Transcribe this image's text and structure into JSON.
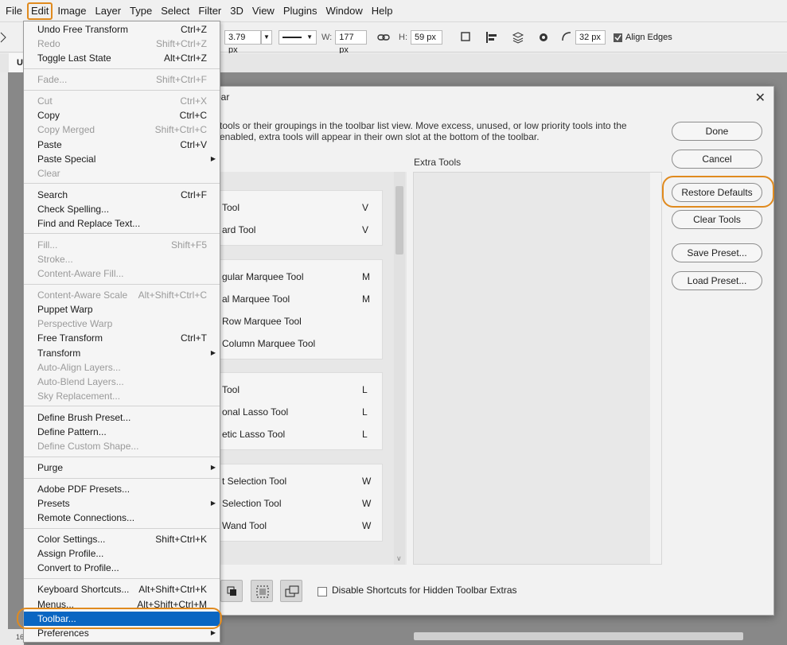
{
  "menubar": [
    "File",
    "Edit",
    "Image",
    "Layer",
    "Type",
    "Select",
    "Filter",
    "3D",
    "View",
    "Plugins",
    "Window",
    "Help"
  ],
  "options": {
    "stroke_width": "3.79 px",
    "w_label": "W:",
    "w_value": "177 px",
    "h_label": "H:",
    "h_value": "59 px",
    "radius": "32 px",
    "align_edges": "Align Edges"
  },
  "doc_tab": "U",
  "ruler_number": "16",
  "edit_menu": {
    "items": [
      {
        "label": "Undo Free Transform",
        "shortcut": "Ctrl+Z",
        "disabled": false
      },
      {
        "label": "Redo",
        "shortcut": "Shift+Ctrl+Z",
        "disabled": true
      },
      {
        "label": "Toggle Last State",
        "shortcut": "Alt+Ctrl+Z",
        "disabled": false
      },
      {
        "sep": true
      },
      {
        "label": "Fade...",
        "shortcut": "Shift+Ctrl+F",
        "disabled": true
      },
      {
        "sep": true
      },
      {
        "label": "Cut",
        "shortcut": "Ctrl+X",
        "disabled": true
      },
      {
        "label": "Copy",
        "shortcut": "Ctrl+C",
        "disabled": false
      },
      {
        "label": "Copy Merged",
        "shortcut": "Shift+Ctrl+C",
        "disabled": true
      },
      {
        "label": "Paste",
        "shortcut": "Ctrl+V",
        "disabled": false
      },
      {
        "label": "Paste Special",
        "shortcut": "",
        "disabled": false,
        "submenu": true
      },
      {
        "label": "Clear",
        "shortcut": "",
        "disabled": true
      },
      {
        "sep": true
      },
      {
        "label": "Search",
        "shortcut": "Ctrl+F",
        "disabled": false
      },
      {
        "label": "Check Spelling...",
        "shortcut": "",
        "disabled": false
      },
      {
        "label": "Find and Replace Text...",
        "shortcut": "",
        "disabled": false
      },
      {
        "sep": true
      },
      {
        "label": "Fill...",
        "shortcut": "Shift+F5",
        "disabled": true
      },
      {
        "label": "Stroke...",
        "shortcut": "",
        "disabled": true
      },
      {
        "label": "Content-Aware Fill...",
        "shortcut": "",
        "disabled": true
      },
      {
        "sep": true
      },
      {
        "label": "Content-Aware Scale",
        "shortcut": "Alt+Shift+Ctrl+C",
        "disabled": true
      },
      {
        "label": "Puppet Warp",
        "shortcut": "",
        "disabled": false
      },
      {
        "label": "Perspective Warp",
        "shortcut": "",
        "disabled": true
      },
      {
        "label": "Free Transform",
        "shortcut": "Ctrl+T",
        "disabled": false
      },
      {
        "label": "Transform",
        "shortcut": "",
        "disabled": false,
        "submenu": true
      },
      {
        "label": "Auto-Align Layers...",
        "shortcut": "",
        "disabled": true
      },
      {
        "label": "Auto-Blend Layers...",
        "shortcut": "",
        "disabled": true
      },
      {
        "label": "Sky Replacement...",
        "shortcut": "",
        "disabled": true
      },
      {
        "sep": true
      },
      {
        "label": "Define Brush Preset...",
        "shortcut": "",
        "disabled": false
      },
      {
        "label": "Define Pattern...",
        "shortcut": "",
        "disabled": false
      },
      {
        "label": "Define Custom Shape...",
        "shortcut": "",
        "disabled": true
      },
      {
        "sep": true
      },
      {
        "label": "Purge",
        "shortcut": "",
        "disabled": false,
        "submenu": true
      },
      {
        "sep": true
      },
      {
        "label": "Adobe PDF Presets...",
        "shortcut": "",
        "disabled": false
      },
      {
        "label": "Presets",
        "shortcut": "",
        "disabled": false,
        "submenu": true
      },
      {
        "label": "Remote Connections...",
        "shortcut": "",
        "disabled": false
      },
      {
        "sep": true
      },
      {
        "label": "Color Settings...",
        "shortcut": "Shift+Ctrl+K",
        "disabled": false
      },
      {
        "label": "Assign Profile...",
        "shortcut": "",
        "disabled": false
      },
      {
        "label": "Convert to Profile...",
        "shortcut": "",
        "disabled": false
      },
      {
        "sep": true
      },
      {
        "label": "Keyboard Shortcuts...",
        "shortcut": "Alt+Shift+Ctrl+K",
        "disabled": false
      },
      {
        "label": "Menus...",
        "shortcut": "Alt+Shift+Ctrl+M",
        "disabled": false
      },
      {
        "label": "Toolbar...",
        "shortcut": "",
        "disabled": false,
        "selected": true
      },
      {
        "label": "Preferences",
        "shortcut": "",
        "disabled": false,
        "submenu": true
      }
    ]
  },
  "dialog": {
    "title": "bar",
    "description_line1": "tools or their groupings in the toolbar list view. Move excess, unused, or low priority tools into the",
    "description_line2": "enabled, extra tools will appear in their own slot at the bottom of the toolbar.",
    "extra_tools_label": "Extra Tools",
    "tool_groups": [
      [
        {
          "name": "Tool",
          "key": "V"
        },
        {
          "name": "ard Tool",
          "key": "V"
        }
      ],
      [
        {
          "name": "gular Marquee Tool",
          "key": "M"
        },
        {
          "name": "al Marquee Tool",
          "key": "M"
        },
        {
          "name": "Row Marquee Tool",
          "key": ""
        },
        {
          "name": "Column Marquee Tool",
          "key": ""
        }
      ],
      [
        {
          "name": "Tool",
          "key": "L"
        },
        {
          "name": "onal Lasso Tool",
          "key": "L"
        },
        {
          "name": "etic Lasso Tool",
          "key": "L"
        }
      ],
      [
        {
          "name": "t Selection Tool",
          "key": "W"
        },
        {
          "name": "Selection Tool",
          "key": "W"
        },
        {
          "name": "Wand Tool",
          "key": "W"
        }
      ]
    ],
    "buttons": {
      "done": "Done",
      "cancel": "Cancel",
      "restore": "Restore Defaults",
      "clear": "Clear Tools",
      "save": "Save Preset...",
      "load": "Load Preset..."
    },
    "disable_shortcuts_label": "Disable Shortcuts for Hidden Toolbar Extras"
  },
  "colors": {
    "highlight": "#e08a1e",
    "menu_selected": "#0a66c2"
  }
}
